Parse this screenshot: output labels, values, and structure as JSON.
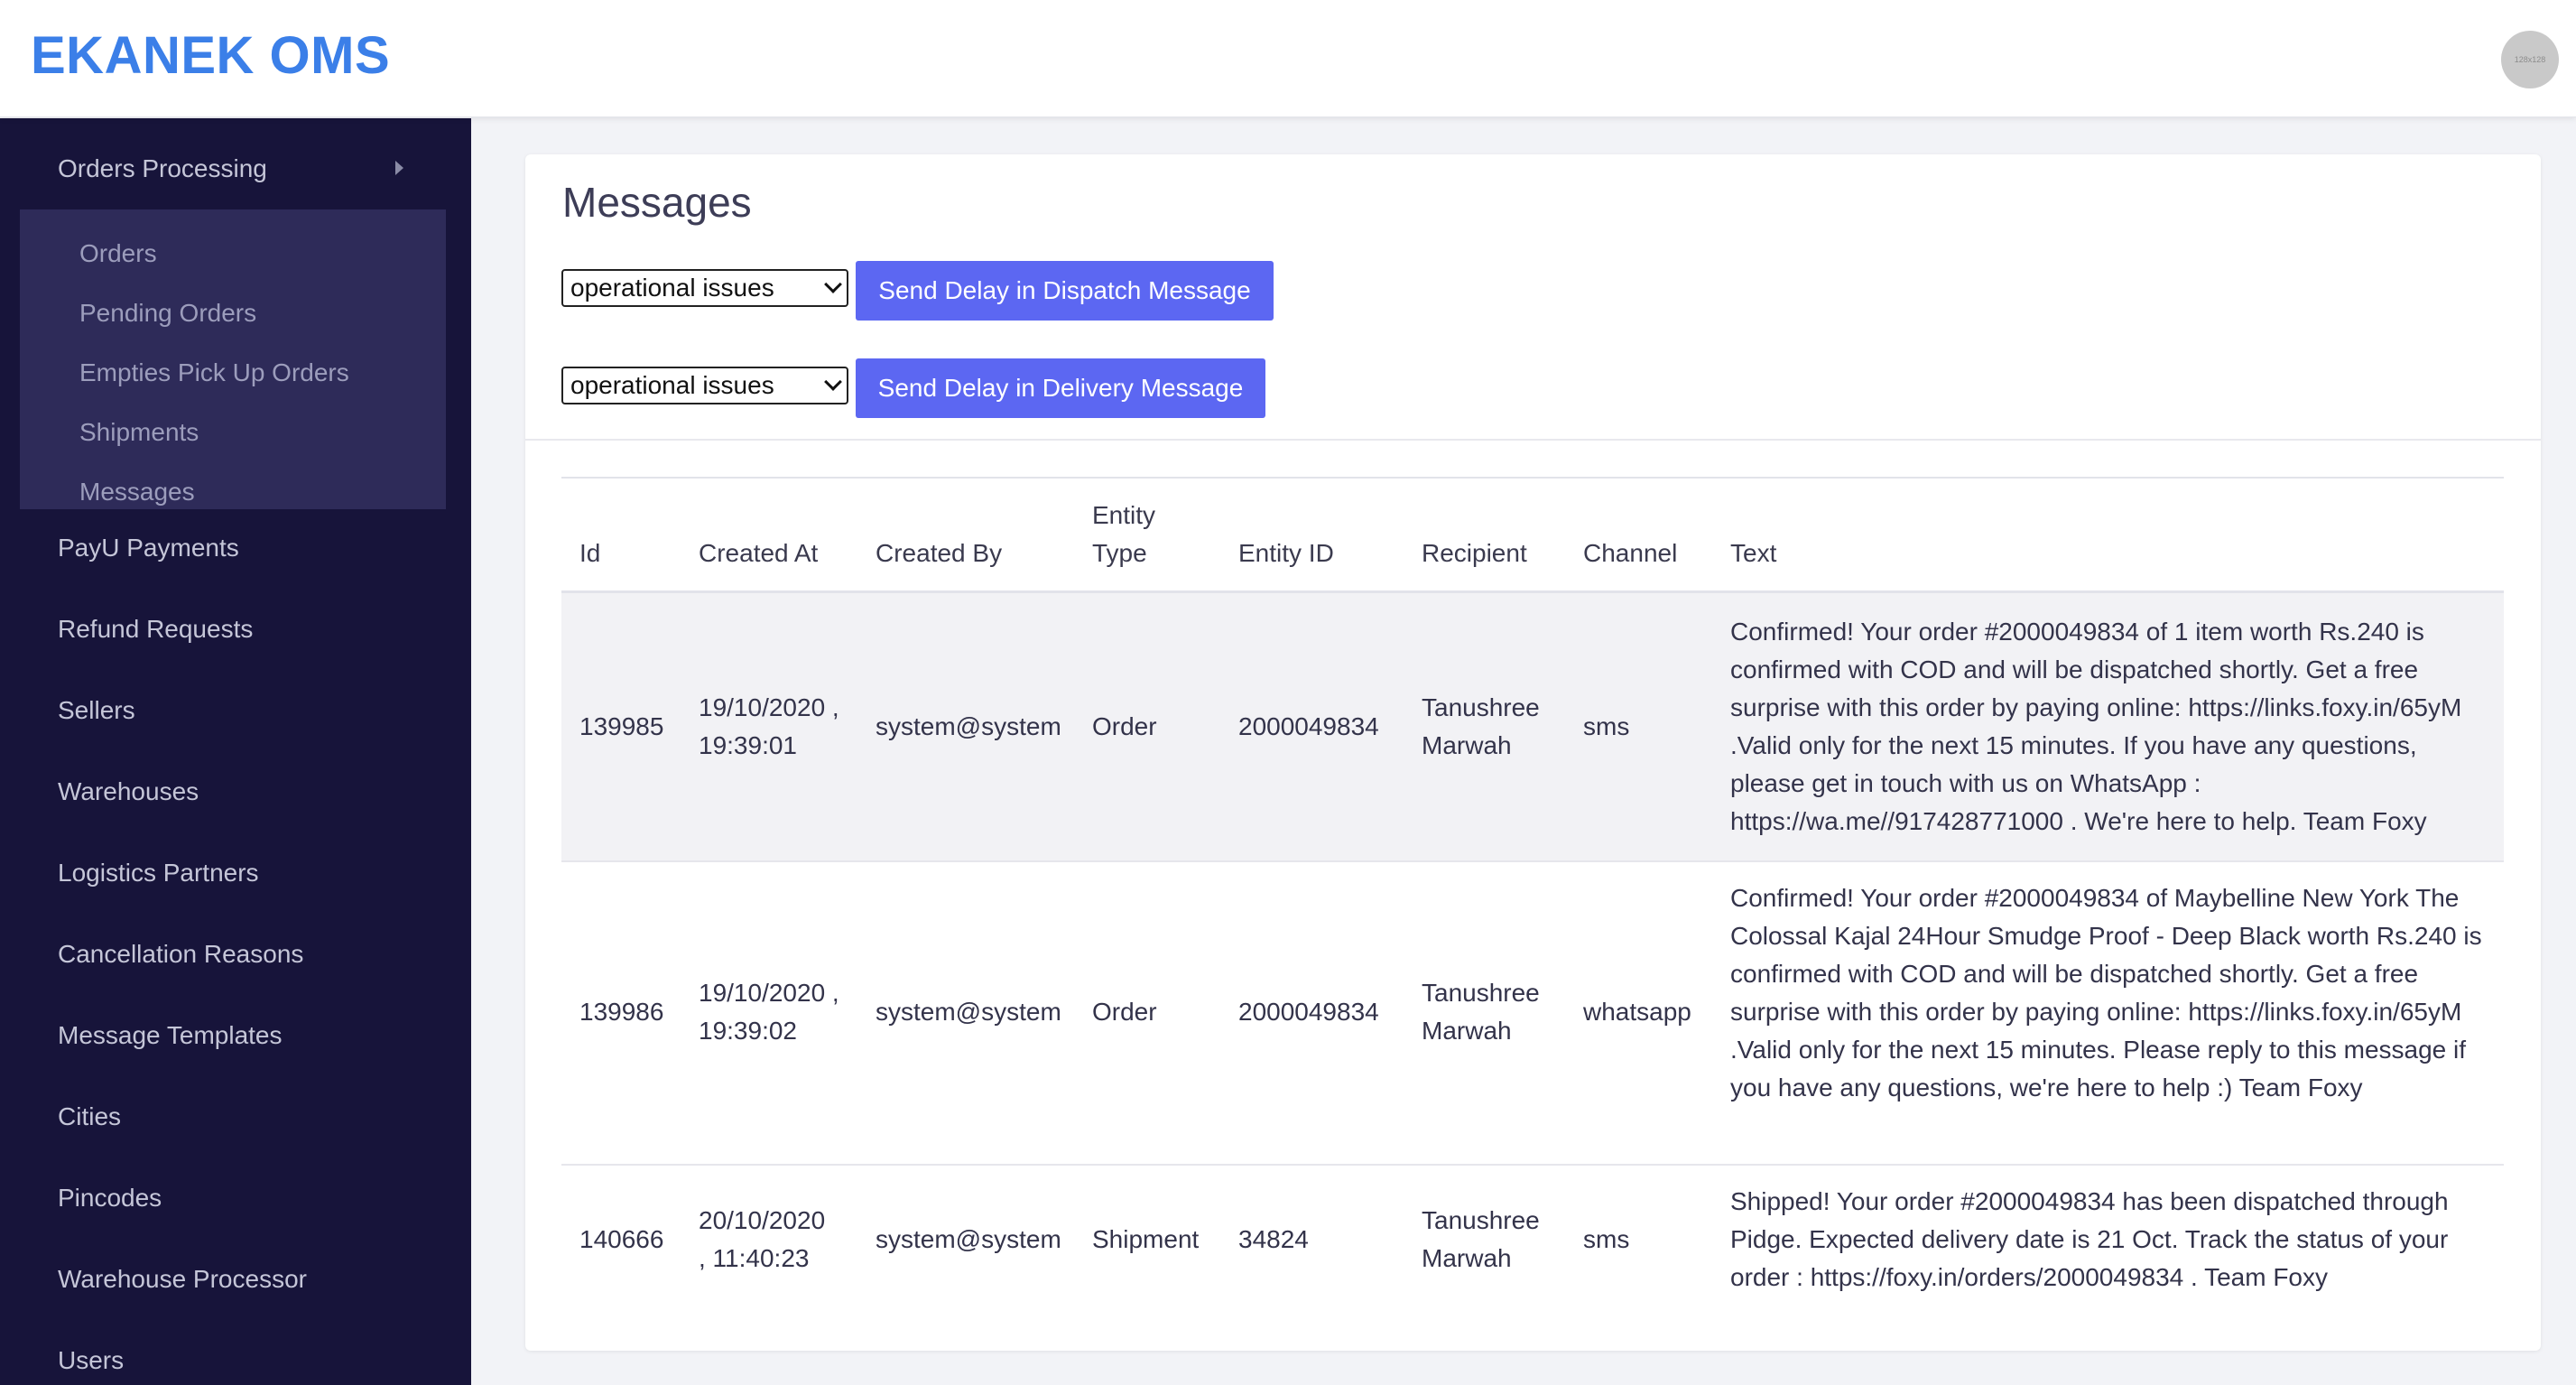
{
  "app": {
    "title": "EKANEK OMS",
    "avatar_text": "128x128"
  },
  "sidebar": {
    "group": {
      "label": "Orders Processing",
      "icon": "chevron-right-icon"
    },
    "sub_items": [
      {
        "label": "Orders"
      },
      {
        "label": "Pending Orders"
      },
      {
        "label": "Empties Pick Up Orders"
      },
      {
        "label": "Shipments"
      },
      {
        "label": "Messages"
      }
    ],
    "items": [
      {
        "label": "PayU Payments"
      },
      {
        "label": "Refund Requests"
      },
      {
        "label": "Sellers"
      },
      {
        "label": "Warehouses"
      },
      {
        "label": "Logistics Partners"
      },
      {
        "label": "Cancellation Reasons"
      },
      {
        "label": "Message Templates"
      },
      {
        "label": "Cities"
      },
      {
        "label": "Pincodes"
      },
      {
        "label": "Warehouse Processor"
      },
      {
        "label": "Users"
      }
    ]
  },
  "main": {
    "title": "Messages",
    "dispatch": {
      "reason": "operational issues",
      "button": "Send Delay in Dispatch Message"
    },
    "delivery": {
      "reason": "operational issues",
      "button": "Send Delay in Delivery Message"
    },
    "table": {
      "headers": {
        "id": "Id",
        "created_at": "Created At",
        "created_by": "Created By",
        "entity_type_1": "Entity",
        "entity_type_2": "Type",
        "entity_id": "Entity ID",
        "recipient": "Recipient",
        "channel": "Channel",
        "text": "Text"
      },
      "rows": [
        {
          "id": "139985",
          "created_at_1": "19/10/2020 ,",
          "created_at_2": "19:39:01",
          "created_by": "system@system",
          "entity_type": "Order",
          "entity_id": "2000049834",
          "recipient_1": "Tanushree",
          "recipient_2": "Marwah",
          "channel": "sms",
          "text": "Confirmed! Your order #2000049834 of 1 item worth Rs.240 is confirmed with COD and will be dispatched shortly. Get a free surprise with this order by paying online: https://links.foxy.in/65yM .Valid only for the next 15 minutes. If you have any questions, please get in touch with us on WhatsApp : https://wa.me//917428771000 . We're here to help. Team Foxy"
        },
        {
          "id": "139986",
          "created_at_1": "19/10/2020 ,",
          "created_at_2": "19:39:02",
          "created_by": "system@system",
          "entity_type": "Order",
          "entity_id": "2000049834",
          "recipient_1": "Tanushree",
          "recipient_2": "Marwah",
          "channel": "whatsapp",
          "text": "Confirmed! Your order #2000049834 of Maybelline New York The Colossal Kajal 24Hour Smudge Proof - Deep Black worth Rs.240 is confirmed with COD and will be dispatched shortly. Get a free surprise with this order by paying online: https://links.foxy.in/65yM .Valid only for the next 15 minutes. Please reply to this message if you have any questions, we're here to help :) Team Foxy"
        },
        {
          "id": "140666",
          "created_at_1": "20/10/2020",
          "created_at_2": ", 11:40:23",
          "created_by": "system@system",
          "entity_type": "Shipment",
          "entity_id": "34824",
          "recipient_1": "Tanushree",
          "recipient_2": "Marwah",
          "channel": "sms",
          "text": "Shipped! Your order #2000049834 has been dispatched through Pidge. Expected delivery date is 21 Oct. Track the status of your order : https://foxy.in/orders/2000049834 . Team Foxy"
        }
      ]
    }
  }
}
